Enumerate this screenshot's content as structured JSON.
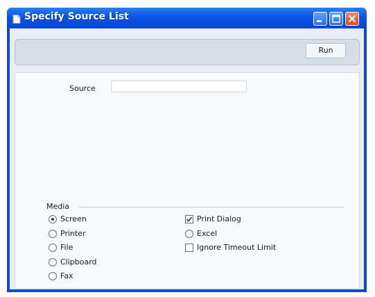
{
  "window": {
    "title": "Specify Source List"
  },
  "toolbar": {
    "run_label": "Run"
  },
  "form": {
    "source_label": "Source",
    "source_value": ""
  },
  "media": {
    "label": "Media",
    "options": [
      {
        "label": "Screen",
        "selected": true
      },
      {
        "label": "Printer",
        "selected": false
      },
      {
        "label": "File",
        "selected": false
      },
      {
        "label": "Clipboard",
        "selected": false
      },
      {
        "label": "Fax",
        "selected": false
      },
      {
        "label": "Excel",
        "selected": false
      }
    ],
    "print_dialog": {
      "label": "Print Dialog",
      "checked": true
    },
    "ignore_timeout": {
      "label": "Ignore Timeout Limit",
      "checked": false
    }
  },
  "colors": {
    "titlebar": "#0a54e4",
    "client_bg": "#e9edf2",
    "close_button": "#d24a22"
  },
  "icons": {
    "app": "document-icon",
    "minimize": "minimize-icon",
    "maximize": "maximize-icon",
    "close": "close-icon"
  }
}
